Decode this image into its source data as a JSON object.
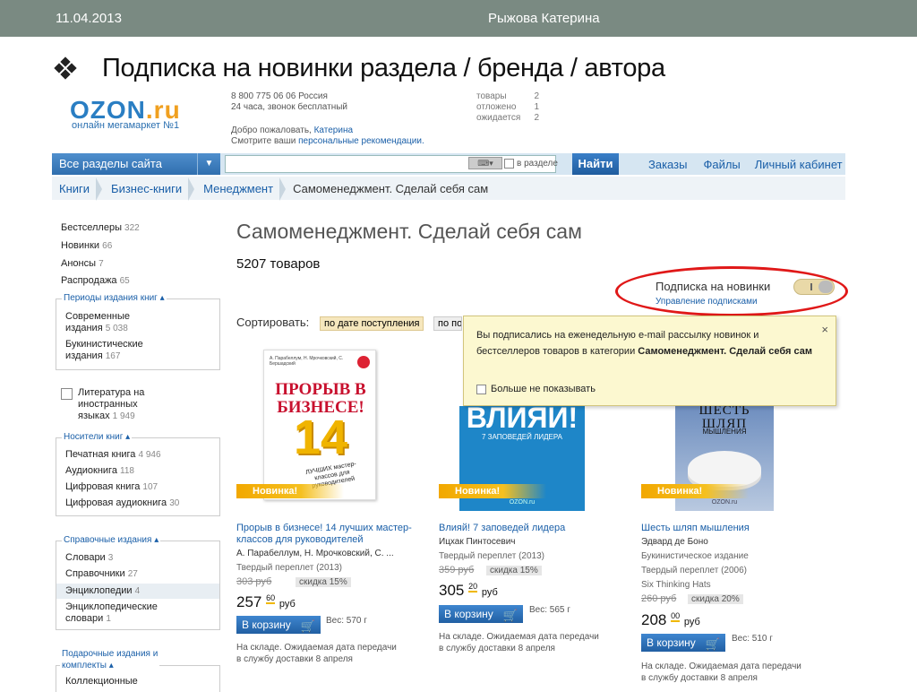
{
  "slide": {
    "date": "11.04.2013",
    "author": "Рыжова Катерина",
    "title": "Подписка на новинки раздела / бренда / автора"
  },
  "site": {
    "logo_main": "OZON",
    "logo_dot_ru": ".ru",
    "logo_sub": "онлайн мегамаркет №1",
    "phone": "8 800 775 06 06 Россия",
    "phone_note": "24 часа, звонок бесплатный",
    "welcome": "Добро пожаловать,",
    "user": "Катерина",
    "rec_prefix": "Смотрите ваши",
    "rec_link": "персональные рекомендации.",
    "cart": [
      {
        "label": "товары",
        "value": "2"
      },
      {
        "label": "отложено",
        "value": "1"
      },
      {
        "label": "ожидается",
        "value": "2"
      }
    ]
  },
  "nav": {
    "sections": "Все разделы сайта",
    "sections_arrow": "▼",
    "kbd": "⌨▾",
    "in_section": "в разделе",
    "find": "Найти",
    "links": [
      "Заказы",
      "Файлы",
      "Личный кабинет"
    ]
  },
  "breadcrumbs": [
    "Книги",
    "Бизнес-книги",
    "Менеджмент"
  ],
  "breadcrumb_current": "Самоменеджмент. Сделай себя сам",
  "sidebar": {
    "top": [
      {
        "label": "Бестселлеры",
        "count": "322"
      },
      {
        "label": "Новинки",
        "count": "66"
      },
      {
        "label": "Анонсы",
        "count": "7"
      },
      {
        "label": "Распродажа",
        "count": "65"
      }
    ],
    "periods_title": "Периоды издания книг ▴",
    "periods": [
      {
        "label1": "Современные",
        "label2": "издания",
        "count": "5 038"
      },
      {
        "label1": "Букинистические",
        "label2": "издания",
        "count": "167"
      }
    ],
    "foreign": {
      "l1": "Литература на",
      "l2": "иностранных",
      "l3": "языках",
      "count": "1 949"
    },
    "media_title": "Носители книг ▴",
    "media": [
      {
        "label": "Печатная книга",
        "count": "4 946"
      },
      {
        "label": "Аудиокнига",
        "count": "118"
      },
      {
        "label": "Цифровая книга",
        "count": "107"
      },
      {
        "label": "Цифровая аудиокнига",
        "count": "30"
      }
    ],
    "ref_title": "Справочные издания ▴",
    "ref": [
      {
        "label": "Словари",
        "count": "3"
      },
      {
        "label": "Справочники",
        "count": "27"
      },
      {
        "label": "Энциклопедии",
        "count": "4"
      }
    ],
    "ref_extra": {
      "l1": "Энциклопедические",
      "l2": "словари",
      "count": "1"
    },
    "gift_title_1": "Подарочные издания и",
    "gift_title_2": "комплекты ▴",
    "gift_item": "Коллекционные"
  },
  "main": {
    "title": "Самоменеджмент. Сделай себя сам",
    "count": "5207 товаров",
    "subscribe_label": "Подписка на новинки",
    "subscribe_manage": "Управление подписками",
    "sort_label": "Сортировать:",
    "sort_opt1": "по дате поступления",
    "sort_opt2": "по популярности"
  },
  "popup": {
    "text_1": "Вы подписались на еженедельную e-mail рассылку новинок и бестселлеров товаров в категории",
    "text_bold": "Самоменеджмент. Сделай себя сам",
    "close": "×",
    "dont_show": "Больше не показывать"
  },
  "books": [
    {
      "cover_top": "А. Парабеллум, Н. Мрочковский, С. Бершадский",
      "cover_main": "ПРОРЫВ В БИЗНЕСЕ!",
      "cover_num": "14",
      "cover_sub": "ЛУЧШИХ мастер-классов для руководителей",
      "badge": "Новинка!",
      "title": "Прорыв в бизнесе! 14 лучших мастер-классов для руководителей",
      "author": "А. Парабеллум, Н. Мрочковский, С. ...",
      "binding": "Твердый переплет (2013)",
      "old_price": "303 руб",
      "discount": "скидка 15%",
      "price_int": "257",
      "price_dec": "60",
      "rub": "руб",
      "cart": "В корзину",
      "weight": "Вес: 570 г",
      "stock1": "На складе. Ожидаемая дата передачи",
      "stock2": "в службу доставки 8 апреля"
    },
    {
      "cover_main": "ВЛИЯЙ!",
      "cover_sub": "7 ЗАПОВЕДЕЙ ЛИДЕРА",
      "cover_brand": "OZON.ru",
      "badge": "Новинка!",
      "title": "Влияй! 7 заповедей лидера",
      "author": "Ицхак Пинтосевич",
      "binding": "Твердый переплет (2013)",
      "old_price": "359 руб",
      "discount": "скидка 15%",
      "price_int": "305",
      "price_dec": "20",
      "rub": "руб",
      "cart": "В корзину",
      "weight": "Вес: 565 г",
      "stock1": "На складе. Ожидаемая дата передачи",
      "stock2": "в службу доставки 8 апреля"
    },
    {
      "cover_main": "ШЕСТЬ ШЛЯП",
      "cover_sub": "МЫШЛЕНИЯ",
      "cover_brand": "OZON.ru",
      "badge": "Новинка!",
      "title": "Шесть шляп мышления",
      "author": "Эдвард де Боно",
      "extra1": "Букинистическое издание",
      "binding": "Твердый переплет (2006)",
      "extra2": "Six Thinking Hats",
      "old_price": "260 руб",
      "discount": "скидка 20%",
      "price_int": "208",
      "price_dec": "00",
      "rub": "руб",
      "cart": "В корзину",
      "weight": "Вес: 510 г",
      "stock1": "На складе. Ожидаемая дата передачи",
      "stock2": "в службу доставки 8 апреля"
    }
  ],
  "colors": {
    "slide_header": "#7a8a82",
    "ozon_blue": "#2a7ec3",
    "ozon_orange": "#f0a020",
    "highlight_red": "#e01818",
    "badge_orange": "#f2a800"
  }
}
